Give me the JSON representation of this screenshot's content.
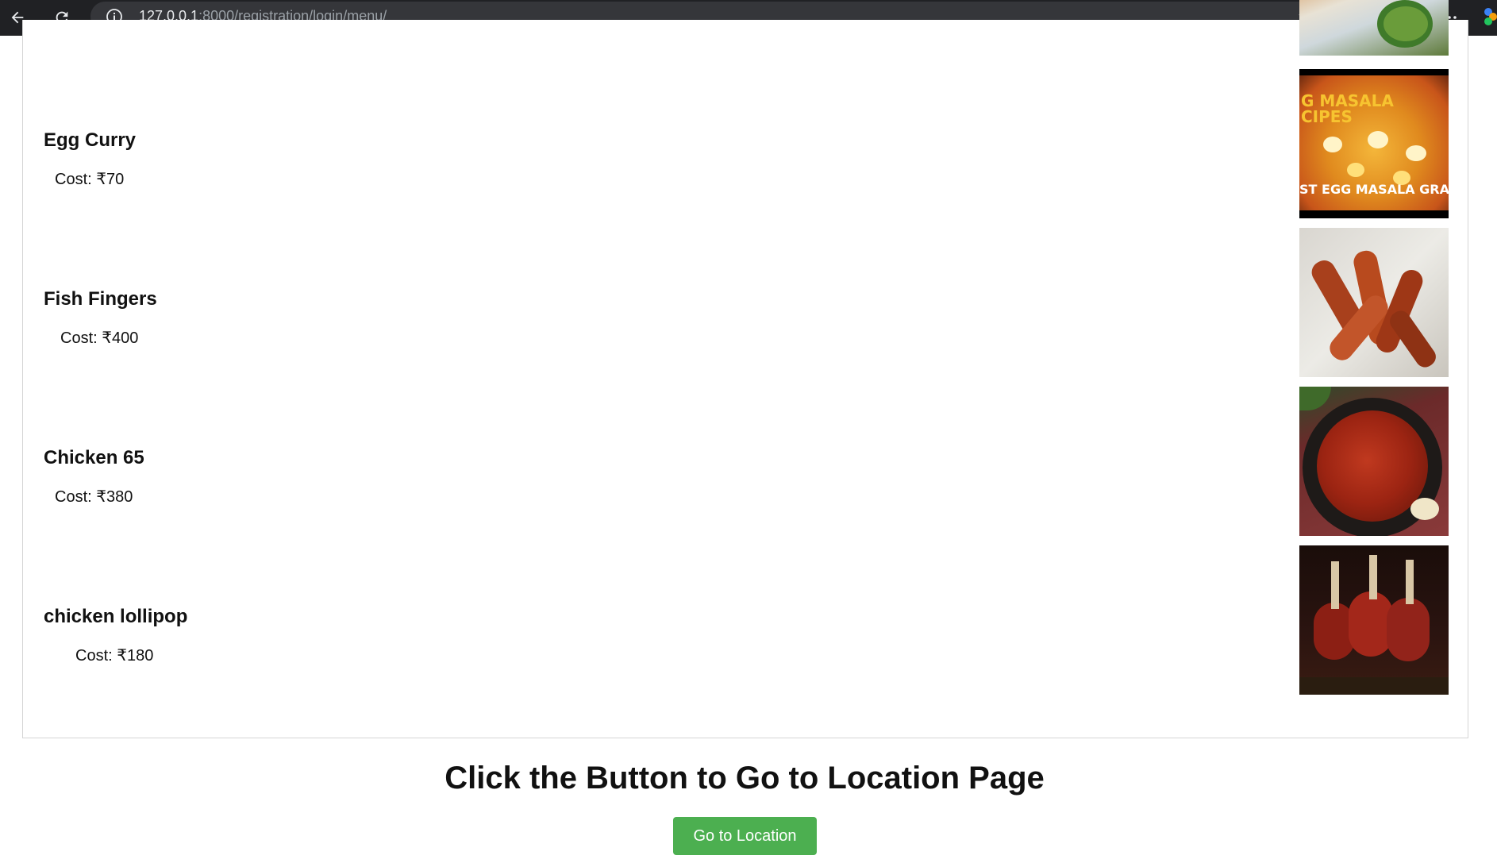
{
  "browser": {
    "url_host": "127.0.0.1",
    "url_rest": ":8000/registration/login/menu/"
  },
  "menu": {
    "items": [
      {
        "name": "Egg Curry",
        "cost": "Cost: ₹70",
        "image": "egg-curry-photo",
        "image_text_top": "G MASALA",
        "image_text_mid": "CIPES",
        "image_text_bottom": "ST EGG MASALA GRA"
      },
      {
        "name": "Fish Fingers",
        "cost": "Cost: ₹400",
        "image": "fish-fingers-photo"
      },
      {
        "name": "Chicken 65",
        "cost": "Cost: ₹380",
        "image": "chicken-65-photo"
      },
      {
        "name": "chicken lollipop",
        "cost": "Cost: ₹180",
        "image": "chicken-lollipop-photo"
      }
    ]
  },
  "cta": {
    "title": "Click the Button to Go to Location Page",
    "button_label": "Go to Location",
    "button_color": "#4caf50"
  }
}
